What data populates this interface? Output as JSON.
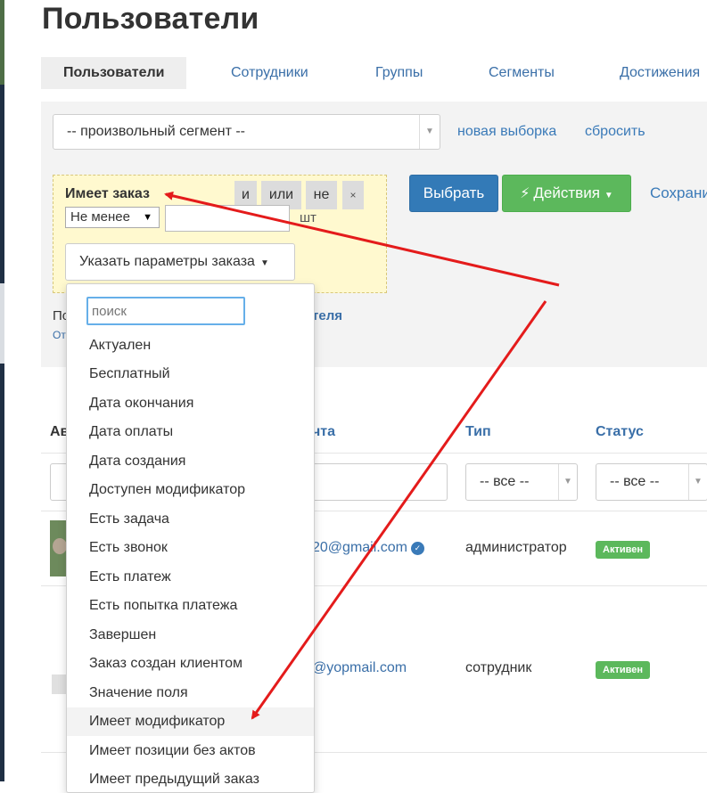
{
  "page": {
    "title": "Пользователи"
  },
  "tabs": [
    {
      "label": "Пользователи",
      "active": true
    },
    {
      "label": "Сотрудники"
    },
    {
      "label": "Группы"
    },
    {
      "label": "Сегменты"
    },
    {
      "label": "Достижения"
    }
  ],
  "filter": {
    "segment_value": "-- произвольный сегмент --",
    "new_selection": "новая выборка",
    "reset": "сбросить",
    "condition": {
      "title": "Имеет заказ",
      "and": "и",
      "or": "или",
      "not": "не",
      "close": "×",
      "operator": "Не менее",
      "count_value": "",
      "unit": "шт",
      "params_button": "Указать параметры заказа"
    },
    "select_button": "Выбрать",
    "actions_button": "Действия",
    "save_partial": "Сохрани",
    "hidden_line_start": "По",
    "hidden_line_end": "теля",
    "hidden_line2": "От"
  },
  "table": {
    "headers": {
      "avatar_partial": "Ав",
      "email_partial": "чта",
      "type": "Тип",
      "status": "Статус"
    },
    "type_filter": "-- все --",
    "status_filter": "-- все --",
    "rows": [
      {
        "email_partial": "20@gmail.com",
        "type": "администратор",
        "status": "Активен"
      },
      {
        "email_partial": "@yopmail.com",
        "type": "сотрудник",
        "status": "Активен"
      }
    ]
  },
  "dropdown": {
    "search_placeholder": "поиск",
    "items": [
      "Актуален",
      "Бесплатный",
      "Дата окончания",
      "Дата оплаты",
      "Дата создания",
      "Доступен модификатор",
      "Есть задача",
      "Есть звонок",
      "Есть платеж",
      "Есть попытка платежа",
      "Завершен",
      "Заказ создан клиентом",
      "Значение поля",
      "Имеет модификатор",
      "Имеет позиции без актов",
      "Имеет предыдущий заказ"
    ],
    "highlighted_index": 13
  },
  "colors": {
    "primary": "#337ab7",
    "success": "#5cb85c",
    "annotation": "#e41b1b",
    "condition_bg": "#fff9cf"
  }
}
